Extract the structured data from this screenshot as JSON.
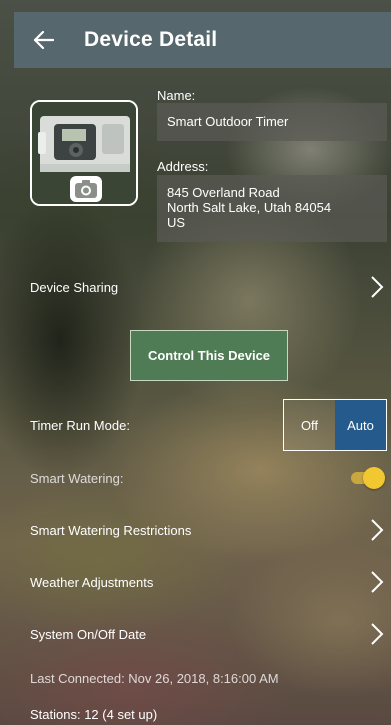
{
  "header": {
    "title": "Device Detail",
    "back_icon": "arrow-left-icon"
  },
  "device": {
    "name_label": "Name:",
    "name_value": "Smart Outdoor Timer",
    "address_label": "Address:",
    "address_line1": "845 Overland Road",
    "address_line2": "North Salt Lake, Utah 84054",
    "address_line3": "US",
    "photo_icon": "camera-icon"
  },
  "sharing": {
    "label": "Device Sharing"
  },
  "control_button": {
    "label": "Control This Device"
  },
  "timer_mode": {
    "label": "Timer Run Mode:",
    "options": [
      "Off",
      "Auto"
    ],
    "selected": "Auto"
  },
  "smart_watering": {
    "label": "Smart Watering:",
    "enabled": true
  },
  "menu": {
    "restrictions": "Smart Watering Restrictions",
    "weather": "Weather Adjustments",
    "system_date": "System On/Off Date"
  },
  "status": {
    "last_connected": "Last Connected: Nov 26, 2018, 8:16:00 AM",
    "stations": "Stations: 12 (4 set up)"
  },
  "colors": {
    "header_bg": "#56686e",
    "control_button_bg": "#507c55",
    "segment_selected_bg": "#255a8c",
    "toggle_on": "#f2c830"
  }
}
